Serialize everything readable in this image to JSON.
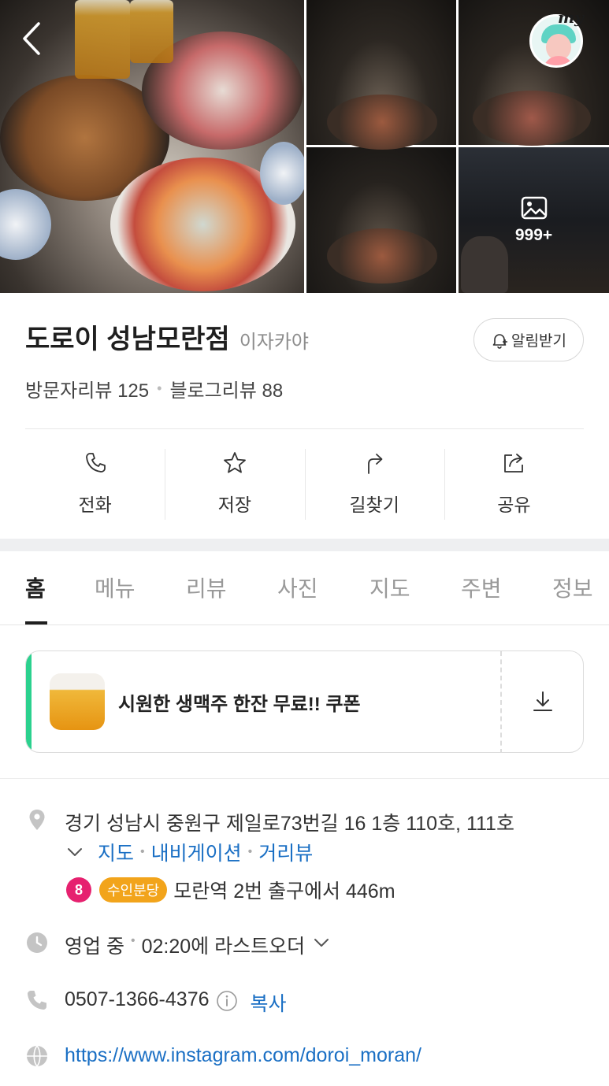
{
  "photos": {
    "more_count": "999+",
    "profile_tag": "my"
  },
  "place": {
    "name": "도로이 성남모란점",
    "category": "이자카야"
  },
  "alert_button": "알림받기",
  "reviews": {
    "visitor": "방문자리뷰 125",
    "blog": "블로그리뷰 88"
  },
  "actions": [
    "전화",
    "저장",
    "길찾기",
    "공유"
  ],
  "tabs": [
    "홈",
    "메뉴",
    "리뷰",
    "사진",
    "지도",
    "주변",
    "정보"
  ],
  "coupon": {
    "text": "시원한 생맥주 한잔 무료!! 쿠폰",
    "accent": "#2bd18e"
  },
  "address": {
    "text": "경기 성남시 중원구 제일로73번길 16 1층 110호, 111호",
    "links": [
      "지도",
      "내비게이션",
      "거리뷰"
    ]
  },
  "transit": {
    "line": "8",
    "line_color": "#e6216f",
    "line_name": "수인분당",
    "line_name_color": "#f2a41b",
    "text": "모란역 2번 출구에서 446m"
  },
  "hours": {
    "status": "영업 중",
    "detail": "02:20에 라스트오더"
  },
  "phone": {
    "number": "0507-1366-4376",
    "copy": "복사"
  },
  "website": {
    "url": "https://www.instagram.com/doroi_moran/"
  },
  "colors": {
    "link": "#1a6fc4",
    "icon_gray": "#c4c4c4"
  }
}
